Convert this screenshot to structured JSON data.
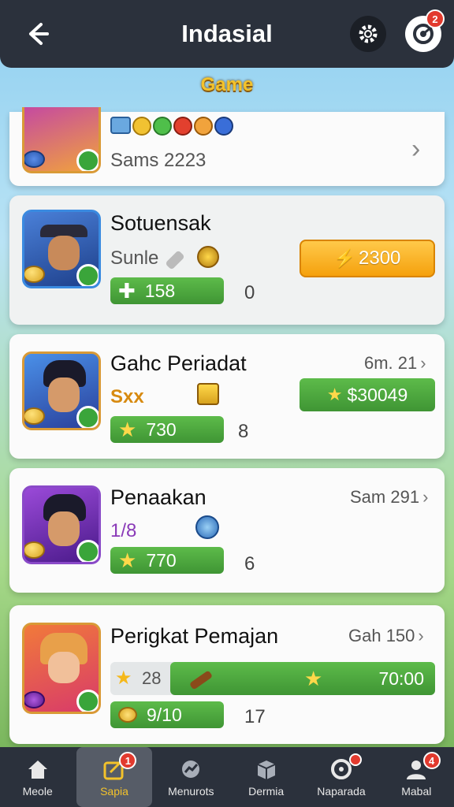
{
  "header": {
    "title": "Indasial",
    "notification_count": "2"
  },
  "section": {
    "label": "Game"
  },
  "cards": [
    {
      "sub": "Sams 2223"
    },
    {
      "name": "Sotuensak",
      "sub": "Sunle",
      "bar": "158",
      "count": "0",
      "action": "2300"
    },
    {
      "name": "Gahc Periadat",
      "sub": "Sxx",
      "bar": "730",
      "count": "8",
      "meta": "6m. 21",
      "action": "$30049"
    },
    {
      "name": "Penaakan",
      "sub": "1/8",
      "bar": "770",
      "count": "6",
      "meta": "Sam 291"
    },
    {
      "name": "Perigkat Pemajan",
      "meta": "Gah 150",
      "sub": "28",
      "progress_value": "70:00",
      "bar": "9/10",
      "count": "17"
    }
  ],
  "nav": [
    {
      "label": "Meole",
      "icon": "home-icon"
    },
    {
      "label": "Sapia",
      "icon": "edit-icon",
      "badge": "1",
      "active": true
    },
    {
      "label": "Menurots",
      "icon": "chart-icon"
    },
    {
      "label": "Dermia",
      "icon": "box-icon"
    },
    {
      "label": "Naparada",
      "icon": "target-icon",
      "badge": ""
    },
    {
      "label": "Mabal",
      "icon": "user-icon",
      "badge": "4"
    }
  ],
  "colors": {
    "accent": "#f3c22b",
    "green": "#4caa3f",
    "orange": "#f5a10d",
    "bar_bg": "#2b313c"
  }
}
